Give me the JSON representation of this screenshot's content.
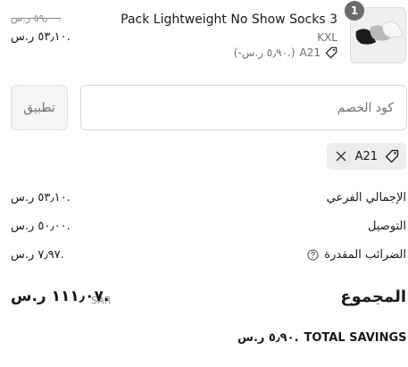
{
  "line_item": {
    "quantity": "1",
    "name": "Pack Lightweight No Show Socks 3",
    "variant": "KXL",
    "discount_code": "A21",
    "discount_amount": "(-٥٫٩٠ ر.س.)",
    "price_original": "٥٩٫٠٠ ر.س.",
    "price_final": "٥٣٫١٠ ر.س."
  },
  "discount_form": {
    "placeholder": "كود الخصم",
    "apply_label": "تطبيق"
  },
  "applied_code": {
    "code": "A21"
  },
  "summary": {
    "subtotal_label": "الإجمالي الفرعي",
    "subtotal_value": "٥٣٫١٠ ر.س.",
    "shipping_label": "التوصيل",
    "shipping_value": "٥٠٫٠٠ ر.س.",
    "taxes_label": "الضرائب المقدرة",
    "taxes_value": "٧٫٩٧ ر.س.",
    "total_label": "المجموع",
    "total_currency": "SAR",
    "total_value": "١١١٫٠٧ ر.س.",
    "savings_label": "TOTAL SAVINGS",
    "savings_value": "٥٫٩٠ ر.س."
  },
  "icons": {
    "tag": "tag-icon",
    "close": "close-icon",
    "help": "help-circle-icon",
    "savings": "tag-icon"
  },
  "colors": {
    "text": "#1a1a1a",
    "muted": "#707070",
    "border": "#d9d9d9",
    "chip_bg": "#ededed",
    "badge_bg": "#6b6b6b"
  }
}
